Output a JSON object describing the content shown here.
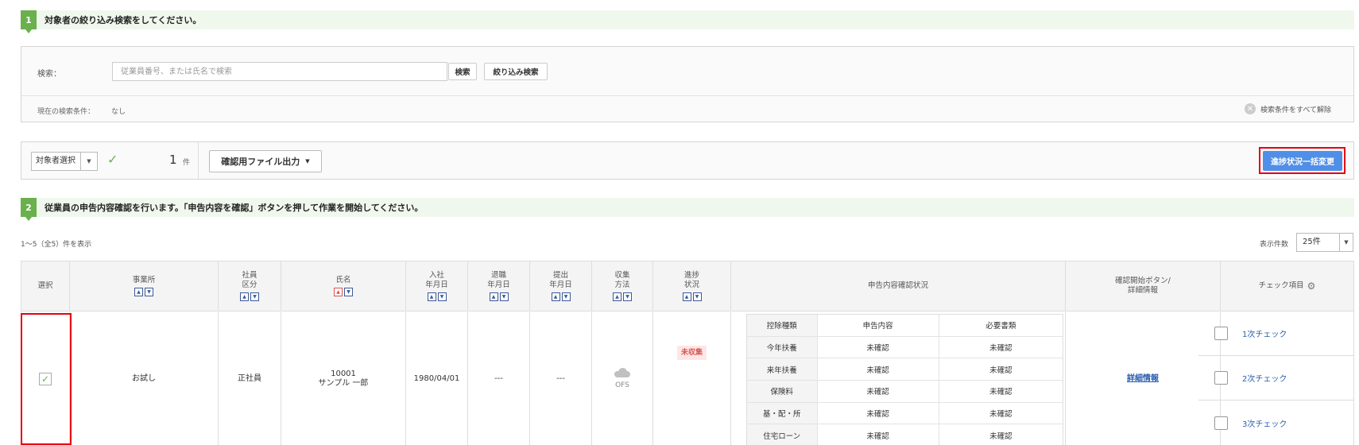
{
  "step1": {
    "num": "1",
    "text": "対象者の絞り込み検索をしてください。"
  },
  "search": {
    "label": "検索：",
    "placeholder": "従業員番号、または氏名で検索",
    "search_button": "検索",
    "filter_button": "絞り込み検索",
    "current_condition_label": "現在の検索条件：",
    "current_condition_value": "なし",
    "clear_all": "検索条件をすべて解除"
  },
  "toolbar": {
    "select_label": "対象者選択",
    "count": "1",
    "count_unit": "件",
    "file_export": "確認用ファイル出力",
    "bulk_change": "進捗状況一括変更"
  },
  "step2": {
    "num": "2",
    "text": "従業員の申告内容確認を行います。「申告内容を確認」ボタンを押して作業を開始してください。"
  },
  "paging": {
    "info": "1～5（全5）件を表示",
    "per_page_label": "表示件数",
    "per_page_value": "25件"
  },
  "table": {
    "headers": {
      "select": "選択",
      "office": "事業所",
      "emp_type": "社員\n区分",
      "name": "氏名",
      "hire_date": "入社\n年月日",
      "retire_date": "退職\n年月日",
      "submit_date": "提出\n年月日",
      "collect_method": "収集\n方法",
      "progress": "進捗\n状況",
      "confirm_status": "申告内容確認状況",
      "start_button": "確認開始ボタン/\n詳細情報",
      "check_items": "チェック項目"
    },
    "row": {
      "office": "お試し",
      "emp_type": "正社員",
      "emp_no": "10001",
      "name": "サンプル 一郎",
      "hire_date": "1980/04/01",
      "retire_date": "---",
      "submit_date": "---",
      "collect_method": "OFS",
      "progress": "未収集",
      "detail_link": "詳細情報"
    },
    "inner_header": [
      "控除種類",
      "申告内容",
      "必要書類"
    ],
    "inner_rows": [
      [
        "今年扶養",
        "未確認",
        "未確認"
      ],
      [
        "来年扶養",
        "未確認",
        "未確認"
      ],
      [
        "保険料",
        "未確認",
        "未確認"
      ],
      [
        "基・配・所",
        "未確認",
        "未確認"
      ],
      [
        "住宅ローン",
        "未確認",
        "未確認"
      ]
    ],
    "check_items": [
      "1次チェック",
      "2次チェック",
      "3次チェック"
    ]
  },
  "colors": {
    "accent_green": "#6ab04c",
    "bulk_button": "#4f8fe8",
    "highlight_red": "#e60012",
    "link_blue": "#2a5db0"
  }
}
